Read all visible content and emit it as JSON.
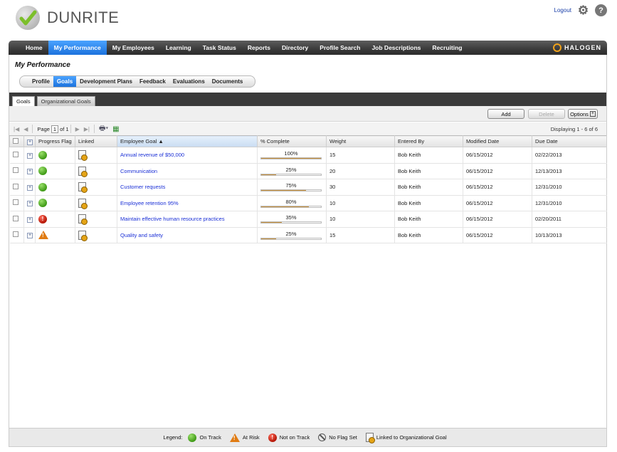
{
  "brand": {
    "name": "DUNRITE",
    "partner": "HALOGEN"
  },
  "top_links": {
    "logout": "Logout"
  },
  "main_nav": [
    {
      "label": "Home",
      "active": false
    },
    {
      "label": "My Performance",
      "active": true
    },
    {
      "label": "My Employees",
      "active": false
    },
    {
      "label": "Learning",
      "active": false
    },
    {
      "label": "Task Status",
      "active": false
    },
    {
      "label": "Reports",
      "active": false
    },
    {
      "label": "Directory",
      "active": false
    },
    {
      "label": "Profile Search",
      "active": false
    },
    {
      "label": "Job Descriptions",
      "active": false
    },
    {
      "label": "Recruiting",
      "active": false
    }
  ],
  "page_title": "My Performance",
  "sub_nav": [
    {
      "label": "Profile",
      "active": false
    },
    {
      "label": "Goals",
      "active": true
    },
    {
      "label": "Development Plans",
      "active": false
    },
    {
      "label": "Feedback",
      "active": false
    },
    {
      "label": "Evaluations",
      "active": false
    },
    {
      "label": "Documents",
      "active": false
    }
  ],
  "tabs": [
    {
      "label": "Goals",
      "active": true
    },
    {
      "label": "Organizational Goals",
      "active": false
    }
  ],
  "actions": {
    "add": "Add",
    "delete": "Delete",
    "options": "Options"
  },
  "pager": {
    "page_label": "Page",
    "page": "1",
    "of_label": "of 1",
    "displaying": "Displaying 1 - 6 of 6"
  },
  "columns": {
    "progress_flag": "Progress Flag",
    "linked": "Linked",
    "employee_goal": "Employee Goal ▲",
    "pct_complete": "% Complete",
    "weight": "Weight",
    "entered_by": "Entered By",
    "modified_date": "Modified Date",
    "due_date": "Due Date"
  },
  "rows": [
    {
      "flag": "on-track",
      "goal": "Annual revenue of $50,000",
      "pct": "100%",
      "pct_value": 100,
      "weight": "15",
      "entered_by": "Bob Keith",
      "modified": "06/15/2012",
      "due": "02/22/2013"
    },
    {
      "flag": "on-track",
      "goal": "Communication",
      "pct": "25%",
      "pct_value": 25,
      "weight": "20",
      "entered_by": "Bob Keith",
      "modified": "06/15/2012",
      "due": "12/13/2013"
    },
    {
      "flag": "on-track",
      "goal": "Customer requests",
      "pct": "75%",
      "pct_value": 75,
      "weight": "30",
      "entered_by": "Bob Keith",
      "modified": "06/15/2012",
      "due": "12/31/2010"
    },
    {
      "flag": "on-track",
      "goal": "Employee retention 95%",
      "pct": "80%",
      "pct_value": 80,
      "weight": "10",
      "entered_by": "Bob Keith",
      "modified": "06/15/2012",
      "due": "12/31/2010"
    },
    {
      "flag": "not-on-track",
      "goal": "Maintain effective human resource practices",
      "pct": "35%",
      "pct_value": 35,
      "weight": "10",
      "entered_by": "Bob Keith",
      "modified": "06/15/2012",
      "due": "02/20/2011"
    },
    {
      "flag": "at-risk",
      "goal": "Quality and safety",
      "pct": "25%",
      "pct_value": 25,
      "weight": "15",
      "entered_by": "Bob Keith",
      "modified": "06/15/2012",
      "due": "10/13/2013"
    }
  ],
  "legend": {
    "title": "Legend:",
    "on_track": "On Track",
    "at_risk": "At Risk",
    "not_on_track": "Not on Track",
    "no_flag": "No Flag Set",
    "linked": "Linked to Organizational Goal"
  },
  "colors": {
    "accent": "#1c72dd",
    "nav_bg": "#3b3b3b",
    "progress_fill": "#c9923c",
    "link": "#1a2fd6"
  }
}
